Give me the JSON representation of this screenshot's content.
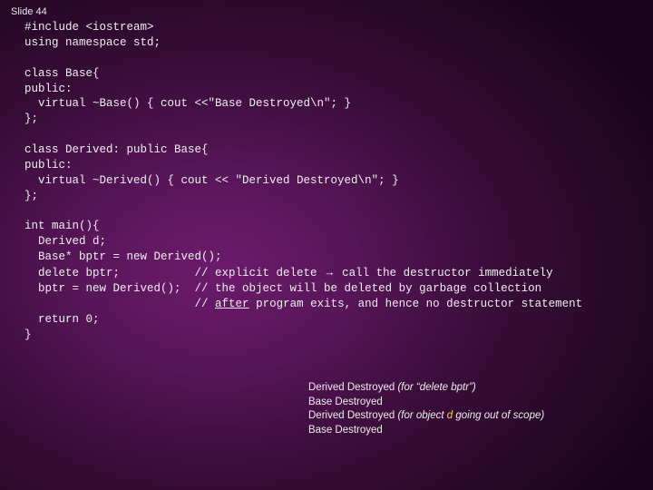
{
  "slide": {
    "title": "Slide 44",
    "code": {
      "l1": "  #include <iostream>",
      "l2": "  using namespace std;",
      "l3": "",
      "l4": "  class Base{",
      "l5": "  public:",
      "l6": "    virtual ~Base() { cout <<\"Base Destroyed\\n\"; }",
      "l7": "  };",
      "l8": "",
      "l9": "  class Derived: public Base{",
      "l10": "  public:",
      "l11": "    virtual ~Derived() { cout << \"Derived Destroyed\\n\"; }",
      "l12": "  };",
      "l13": "",
      "l14": "  int main(){",
      "l15": "    Derived d;",
      "l16": "    Base* bptr = new Derived();",
      "l17a": "    delete bptr;           // explicit delete ",
      "l17b": " call the destructor immediately",
      "l18": "    bptr = new Derived();  // the object will be deleted by garbage collection",
      "l19a": "                           // ",
      "l19b": "after",
      "l19c": " program exits, and hence no destructor statement",
      "l20": "    return 0;",
      "l21": "  }"
    },
    "arrow": "→",
    "output": {
      "r1a": "Derived Destroyed ",
      "r1b": "(for ",
      "r1c": "“delete bptr”",
      "r1d": ")",
      "r2": "Base Destroyed",
      "r3a": "Derived Destroyed ",
      "r3b": "(for object ",
      "r3c": "d",
      "r3d": " going out of scope)",
      "r4": "Base Destroyed"
    }
  }
}
